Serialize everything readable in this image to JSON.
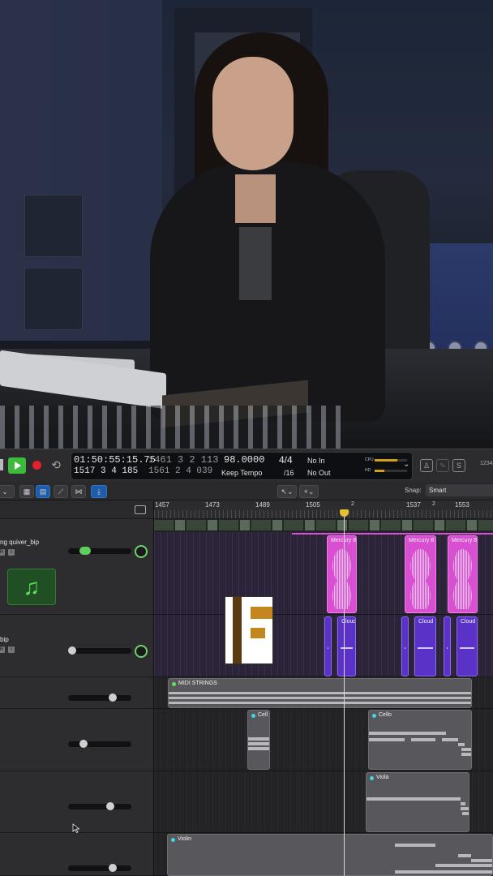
{
  "transport": {
    "timecode": "01:50:55:15.75",
    "bars_main": "1461  3  2  113",
    "bars_sub": "1517  3  4  185",
    "bars_sub2": "1561  2  4  039",
    "tempo": "98.0000",
    "tempo_mode": "Keep Tempo",
    "signature": "4/4",
    "division": "/16",
    "in_label": "No In",
    "out_label": "No Out",
    "cpu_label": "CPU",
    "hd_label": "HD",
    "cpu_level": 0.7,
    "hd_level": 0.3,
    "right_counter": "1234"
  },
  "toolbar2": {
    "snap_label": "Snap:",
    "snap_value": "Smart"
  },
  "ruler": {
    "marks": [
      "1457",
      "1473",
      "1489",
      "1505",
      "1537",
      "1553"
    ],
    "small_marks": [
      "2",
      "2"
    ]
  },
  "tracks": [
    {
      "name": "ng quiver_bip",
      "btn_r": "R",
      "btn_i": "I"
    },
    {
      "name": "bip",
      "btn_r": "R",
      "btn_i": "I"
    },
    {
      "name": ""
    },
    {
      "name": ""
    },
    {
      "name": ""
    },
    {
      "name": ""
    }
  ],
  "regions": {
    "audio_label": "Mercury 8",
    "cloud_label": "Cloud",
    "strings_label": "MIDI STRINGS",
    "cell_label": "Cell",
    "cello_label": "Cello",
    "viola_label": "Viola",
    "violin_label": "Violin"
  },
  "colors": {
    "audio_region": "#d94fd2",
    "cloud_region": "#5a32c8",
    "midi_region": "#58585c",
    "play": "#3bba3b",
    "record": "#e2222b",
    "playhead": "#e5c032"
  },
  "icons": {
    "instrument": "music-note-icon",
    "logo": "if-logo"
  }
}
